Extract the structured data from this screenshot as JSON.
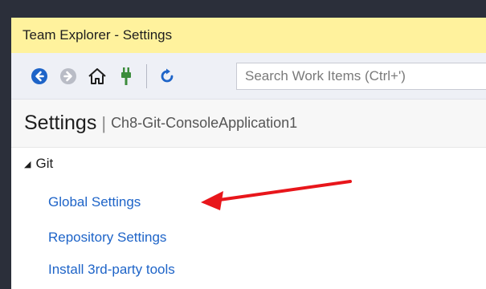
{
  "window": {
    "title": "Team Explorer - Settings"
  },
  "toolbar": {
    "buttons": [
      {
        "name": "back",
        "icon": "back-arrow-icon"
      },
      {
        "name": "forward",
        "icon": "forward-arrow-icon"
      },
      {
        "name": "home",
        "icon": "home-icon"
      },
      {
        "name": "connect",
        "icon": "plug-icon"
      },
      {
        "name": "refresh",
        "icon": "refresh-icon"
      }
    ],
    "search_placeholder": "Search Work Items (Ctrl+')"
  },
  "header": {
    "title": "Settings",
    "separator": "|",
    "context": "Ch8-Git-ConsoleApplication1"
  },
  "section": {
    "expander": "◢",
    "label": "Git",
    "links": [
      {
        "label": "Global Settings"
      },
      {
        "label": "Repository Settings"
      },
      {
        "label": "Install 3rd-party tools"
      }
    ]
  },
  "annotation": {
    "arrow_color": "#e8161b"
  },
  "colors": {
    "titlebar_bg": "#fff29d",
    "toolbar_bg": "#eef0f6",
    "link": "#1e64c8",
    "nav_blue": "#1e64c8",
    "plug_green": "#3c8c3c"
  }
}
